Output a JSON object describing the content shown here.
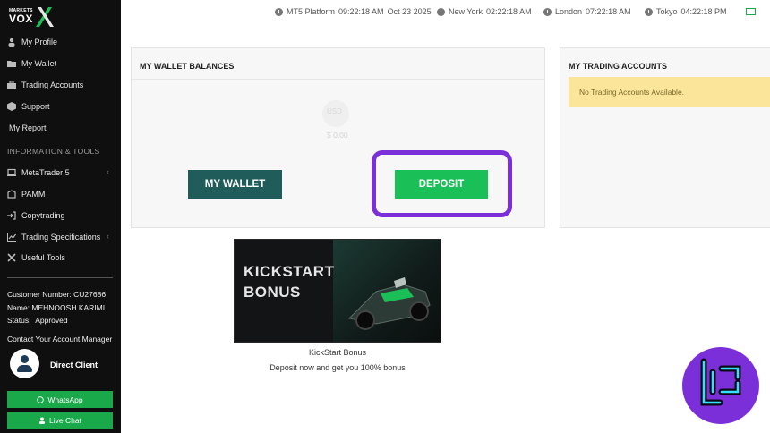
{
  "logo": {
    "small": "MARKETS",
    "big": "VOX",
    "mark": "X"
  },
  "sidebar": {
    "items": [
      {
        "label": "My Profile",
        "icon": "user-icon"
      },
      {
        "label": "My Wallet",
        "icon": "folder-icon"
      },
      {
        "label": "Trading Accounts",
        "icon": "briefcase-icon"
      },
      {
        "label": "Support",
        "icon": "cube-icon"
      },
      {
        "label": "My Report",
        "icon": ""
      }
    ],
    "section_header": "INFORMATION & TOOLS",
    "tools": [
      {
        "label": "MetaTrader 5",
        "icon": "laptop-icon",
        "has_submenu": true
      },
      {
        "label": "PAMM",
        "icon": "pamm-icon"
      },
      {
        "label": "Copytrading",
        "icon": "signin-icon"
      },
      {
        "label": "Trading Specifications",
        "icon": "chart-icon",
        "has_submenu": true
      },
      {
        "label": "Useful Tools",
        "icon": "tools-icon"
      }
    ],
    "customer_number_label": "Customer Number: CU27686",
    "name_label": "Name: MEHNOOSH KARIMI",
    "status_label": "Status:",
    "status_value": "Approved",
    "contact_label": "Contact Your Account Manager",
    "manager_name": "Direct Client",
    "whatsapp_label": "WhatsApp",
    "livechat_label": "Live Chat"
  },
  "topbar": {
    "clocks": [
      {
        "label": "MT5 Platform",
        "time": "09:22:18 AM",
        "date": "Oct 23 2025"
      },
      {
        "label": "New York",
        "time": "02:22:18 AM"
      },
      {
        "label": "London",
        "time": "07:22:18 AM"
      },
      {
        "label": "Tokyo",
        "time": "04:22:18 PM"
      }
    ]
  },
  "wallet": {
    "title": "MY WALLET BALANCES",
    "currency": "USD",
    "amount": "$ 0.00",
    "my_wallet_button": "MY WALLET",
    "deposit_button": "DEPOSIT"
  },
  "trading": {
    "title": "MY TRADING ACCOUNTS",
    "empty_message": "No Trading Accounts Available."
  },
  "promo": {
    "banner_line1": "KICKSTART",
    "banner_line2": "BONUS",
    "caption": "KickStart Bonus",
    "subtitle": "Deposit now and get you 100% bonus"
  },
  "colors": {
    "sidebar_bg": "#0f0f0f",
    "accent_green": "#1bbf58",
    "wallet_button": "#1f5c5a",
    "highlight_purple": "#7b2fd9",
    "alert_yellow": "#fbe59a"
  }
}
